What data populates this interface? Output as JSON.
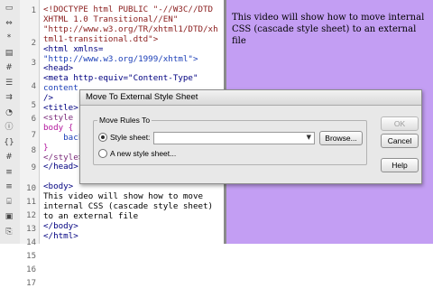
{
  "toolbar": {
    "tools": [
      {
        "icon": "file-icon",
        "glyph": "▭"
      },
      {
        "icon": "expand-icon",
        "glyph": "⇔"
      },
      {
        "icon": "collapse-icon",
        "glyph": "*"
      },
      {
        "icon": "select-tag-icon",
        "glyph": "▤"
      },
      {
        "icon": "line-numbers-icon",
        "glyph": "#"
      },
      {
        "icon": "highlight-icon",
        "glyph": "☰"
      },
      {
        "icon": "word-wrap-icon",
        "glyph": "⇉"
      },
      {
        "icon": "comment-icon",
        "glyph": "◔"
      },
      {
        "icon": "info-icon",
        "glyph": "ⓘ"
      },
      {
        "icon": "braces-icon",
        "glyph": "{}"
      },
      {
        "icon": "syntax-icon",
        "glyph": "#"
      },
      {
        "icon": "indent-icon",
        "glyph": "≡"
      },
      {
        "icon": "outdent-icon",
        "glyph": "≡"
      },
      {
        "icon": "format-icon",
        "glyph": "⌸"
      },
      {
        "icon": "snippet-icon",
        "glyph": "▣"
      },
      {
        "icon": "paste-icon",
        "glyph": "⎘"
      }
    ]
  },
  "editor": {
    "line_numbers": [
      "1",
      "2",
      "3",
      "4",
      "5",
      "6",
      "7",
      "8",
      "9",
      "10",
      "11",
      "12",
      "13",
      "14",
      "15",
      "16",
      "17"
    ],
    "code_lines": [
      {
        "text": "<!DOCTYPE html PUBLIC \"-//W3C//DTD",
        "color": "#8a1d1d"
      },
      {
        "text": "XHTML 1.0 Transitional//EN\"",
        "color": "#8a1d1d"
      },
      {
        "text": "\"http://www.w3.org/TR/xhtml1/DTD/xh",
        "color": "#8a1d1d"
      },
      {
        "text": "tml1-transitional.dtd\">",
        "color": "#8a1d1d"
      },
      {
        "text": "<html xmlns=",
        "color": "#000080"
      },
      {
        "text": "\"http://www.w3.org/1999/xhtml\">",
        "color": "#1d40b8"
      },
      {
        "text": "<head>",
        "color": "#000080"
      },
      {
        "text": "<meta http-equiv=\"Content-Type\"",
        "color": "#000080"
      },
      {
        "text": "content",
        "color": "#1d40b8"
      },
      {
        "text": "/>",
        "color": "#000080"
      },
      {
        "text": "<title>",
        "color": "#000080"
      },
      {
        "text": "<style",
        "color": "#7a2a7a"
      },
      {
        "text": "body {",
        "color": "#b3179e"
      },
      {
        "text": "    back",
        "color": "#1d40b8"
      },
      {
        "text": "}",
        "color": "#b3179e"
      },
      {
        "text": "</style>",
        "color": "#7a2a7a"
      },
      {
        "text": "</head>",
        "color": "#000080"
      },
      {
        "text": "",
        "color": "#000"
      },
      {
        "text": "<body>",
        "color": "#000080"
      },
      {
        "text": "This video will show how to move",
        "color": "#000000"
      },
      {
        "text": "internal CSS (cascade style sheet)",
        "color": "#000000"
      },
      {
        "text": "to an external file",
        "color": "#000000"
      },
      {
        "text": "</body>",
        "color": "#000080"
      },
      {
        "text": "</html>",
        "color": "#000080"
      }
    ]
  },
  "design_view": {
    "text": "This video will show how to move internal CSS (cascade style sheet) to an external file",
    "background": "#c39ef3"
  },
  "dialog": {
    "title": "Move To External Style Sheet",
    "group_label": "Move Rules To",
    "option_style_sheet": "Style sheet:",
    "option_new_style_sheet": "A new style sheet...",
    "selected_option": "Style sheet:",
    "style_sheet_value": "",
    "browse_label": "Browse...",
    "ok_label": "OK",
    "cancel_label": "Cancel",
    "help_label": "Help"
  }
}
